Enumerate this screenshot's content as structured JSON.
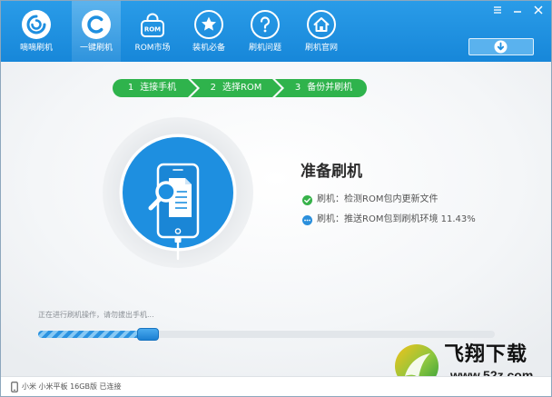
{
  "colors": {
    "accent": "#1e8fe0",
    "topbar_top": "#2a9ce8",
    "topbar_bottom": "#1787d9",
    "step_green": "#2fb34c",
    "check_green": "#37b24a",
    "text_dark": "#2b2b2b"
  },
  "window": {
    "menu_icon": "menu-icon",
    "minimize_icon": "minimize-icon",
    "close_icon": "close-icon"
  },
  "nav": {
    "items": [
      {
        "label": "嘀嘀刷机",
        "icon": "app-logo-icon"
      },
      {
        "label": "一键刷机",
        "icon": "one-click-flash-icon",
        "selected": true
      },
      {
        "label": "ROM市场",
        "icon": "rom-bag-icon",
        "icon_text": "ROM"
      },
      {
        "label": "装机必备",
        "icon": "star-icon"
      },
      {
        "label": "刷机问题",
        "icon": "question-icon"
      },
      {
        "label": "刷机官网",
        "icon": "home-icon"
      }
    ]
  },
  "download_button": {
    "icon": "download-arrow-icon"
  },
  "steps": [
    {
      "number": "1",
      "label": "连接手机"
    },
    {
      "number": "2",
      "label": "选择ROM"
    },
    {
      "number": "3",
      "label": "备份并刷机"
    }
  ],
  "flash_status": {
    "title": "准备刷机",
    "illustration_icons": [
      "phone-icon",
      "document-icon",
      "magnifier-icon"
    ],
    "tasks": [
      {
        "icon": "check-circle-icon",
        "text": "刷机：检测ROM包内更新文件"
      },
      {
        "icon": "spinner-icon",
        "text": "刷机：推送ROM包到刷机环境 11.43%"
      }
    ]
  },
  "progress": {
    "message": "正在进行刷机操作，请勿拔出手机...",
    "fraction": 0.24
  },
  "statusbar": {
    "icon": "phone-icon",
    "device": "小米 小米平板 16GB版 已连接"
  },
  "watermark": {
    "icon": "watermark-logo-icon",
    "brand": "飞翔下载",
    "url": "www.52z.com"
  }
}
